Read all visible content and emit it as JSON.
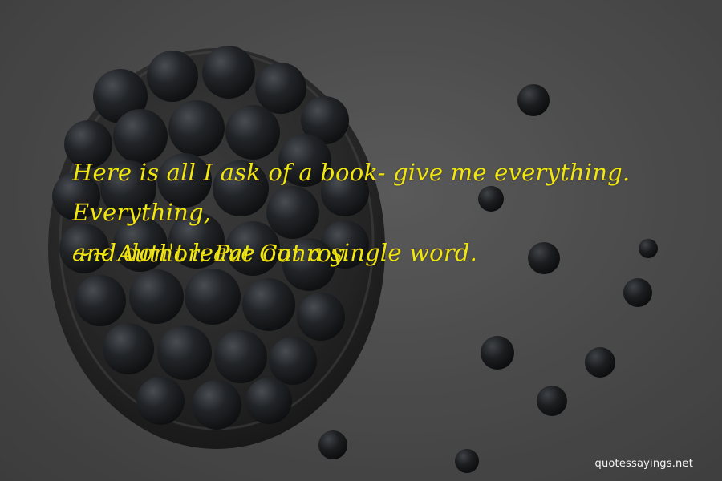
{
  "quote": {
    "line1": "Here is all I ask of a book- give me everything. Everything,",
    "line2": "and don't leave out a single word.",
    "author_prefix": "~~",
    "author_label": "Author:",
    "author_name": "Pat Conroy",
    "text_color": "#f2e60f"
  },
  "background": {
    "description_icon": "blueberries-bowl-photo"
  },
  "watermark": {
    "text": "quotessayings.net"
  }
}
